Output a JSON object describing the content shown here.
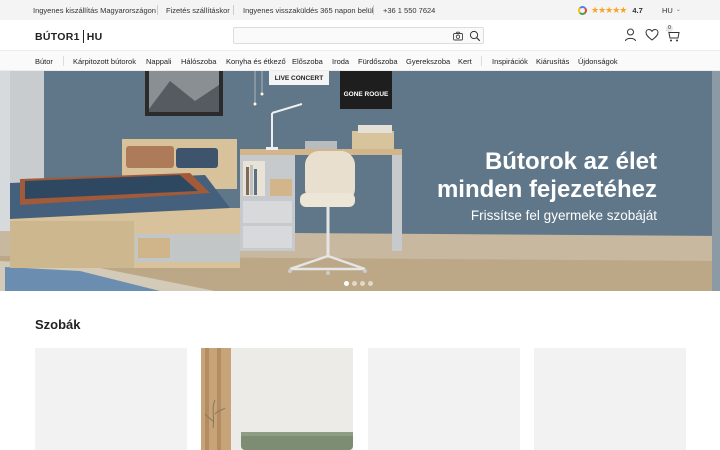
{
  "topbar": {
    "shipping": "Ingyenes kiszállítás Magyarországon",
    "payment": "Fizetés szállításkor",
    "returns": "Ingyenes visszaküldés 365 napon belül",
    "phone": "+36 1 550 7624",
    "rating_icon": "google-icon",
    "rating": "4.7",
    "stars": 4.7,
    "lang": "HU"
  },
  "header": {
    "logo_left": "BÚTOR1",
    "logo_right": "HU",
    "search_placeholder": "",
    "cart_count": "0"
  },
  "nav": {
    "items": [
      "Bútor",
      "Kárpitozott bútorok",
      "Nappali",
      "Hálószoba",
      "Konyha és étkező",
      "Előszoba",
      "Iroda",
      "Fürdőszoba",
      "Gyerekszoba",
      "Kert",
      "Inspirációk",
      "Kiárusítás",
      "Újdonságok"
    ]
  },
  "hero": {
    "title": "Bútorok az élet minden fejezetéhez",
    "subtitle": "Frissítse fel gyermeke szobáját",
    "poster1": "LIVE CONCERT",
    "poster2": "GONE ROGUE",
    "slide_count": 4,
    "active_slide": 1
  },
  "rooms": {
    "title": "Szobák"
  },
  "colors": {
    "wall": "#5f7788",
    "accent_star": "#f5a623"
  }
}
